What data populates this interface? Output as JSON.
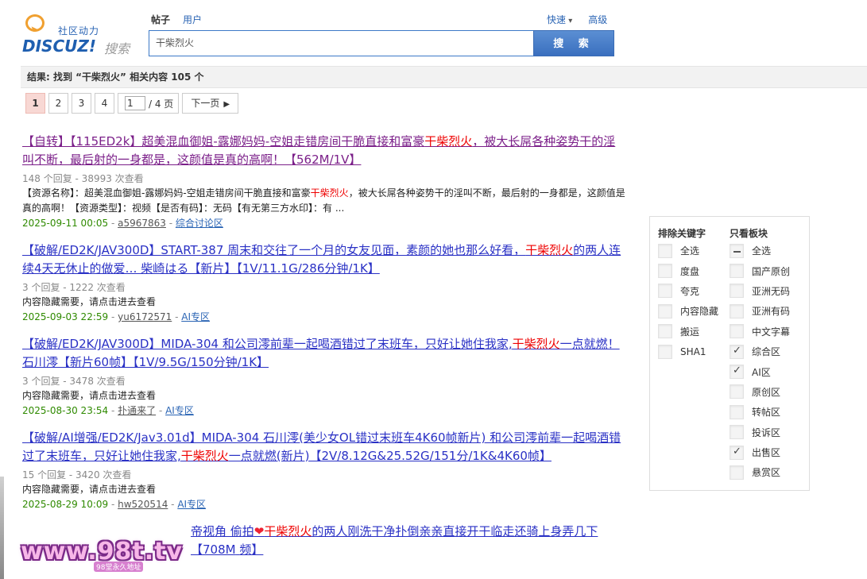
{
  "logo": {
    "cn": "社区动力",
    "word": "DISCUZ!",
    "sou": "搜索"
  },
  "search_tabs": [
    "帖子",
    "用户"
  ],
  "search_options": {
    "quick": "快速",
    "advanced": "高级"
  },
  "search": {
    "value": "干柴烈火",
    "button": "搜 索"
  },
  "result_summary": "结果: 找到 “干柴烈火” 相关内容 105 个",
  "pager": {
    "pages": [
      "1",
      "2",
      "3",
      "4"
    ],
    "current_input": "1",
    "total": "/ 4 页",
    "next": "下一页"
  },
  "results": [
    {
      "title_pre": "【自转】【115ED2k】超美混血御姐-露娜妈妈-空姐走错房间干脆直接和富豪",
      "title_hl": "干柴烈火",
      "title_post": "，被大长屌各种姿势干的淫叫不断，最后射的一身都是，这颜值是真的高啊！【562M/1V】",
      "meta": "148 个回复 - 38993 次查看",
      "desc_pre": "【资源名称】：超美混血御姐-露娜妈妈-空姐走错房间干脆直接和富豪",
      "desc_hl": "干柴烈火",
      "desc_post": "，被大长屌各种姿势干的淫叫不断，最后射的一身都是，这颜值是真的高啊！【资源类型】：视频【是否有码】：无码【有无第三方水印】：有 ...",
      "date": "2025-09-11 00:05",
      "author": "a5967863",
      "forum": "综合讨论区"
    },
    {
      "title_pre": "【破解/ED2K/JAV300D】START-387 周末和交往了一个月的女友见面，素颜的她也那么好看，",
      "title_hl": "干柴烈火",
      "title_post": "的两人连续4天无休止的做爱… 柴崎はる【新片】【1V/11.1G/286分钟/1K】",
      "meta": "3 个回复 - 1222 次查看",
      "desc": "内容隐藏需要，请点击进去查看",
      "date": "2025-09-03 22:59",
      "author": "yu6172571",
      "forum": "AI专区"
    },
    {
      "title_pre": "【破解/ED2K/JAV300D】MIDA-304 和公司澪前辈一起喝酒错过了末班车，只好让她住我家,",
      "title_hl": "干柴烈火",
      "title_post": "一点就燃！石川澪【新片60帧】【1V/9.5G/150分钟/1K】",
      "meta": "3 个回复 - 3478 次查看",
      "desc": "内容隐藏需要，请点击进去查看",
      "date": "2025-08-30 23:54",
      "author": "扑通来了",
      "forum": "AI专区"
    },
    {
      "title_pre": "【破解/AI增强/ED2K/Jav3.01d】MIDA-304 石川澪(美少女OL错过末班车4K60帧新片) 和公司澪前辈一起喝酒错过了末班车，只好让她住我家,",
      "title_hl": "干柴烈火",
      "title_post": "一点就燃(新片)【2V/8.12G&25.52G/151分/1K&4K60帧】",
      "meta": "15 个回复 - 3420 次查看",
      "desc": "内容隐藏需要，请点击进去查看",
      "date": "2025-08-29 10:09",
      "author": "hw520514",
      "forum": "AI专区"
    },
    {
      "title_pre": "帝视角 偷拍",
      "title_hl": "干柴烈火",
      "title_post": "的两人刚洗干净扑倒亲亲直接开干临走还骑上身弄几下【708M",
      "title_tail": "频】"
    }
  ],
  "filter": {
    "exclude_header": "排除关键字",
    "exclude": [
      "全选",
      "度盘",
      "夸克",
      "内容隐藏",
      "搬运",
      "SHA1"
    ],
    "only_header": "只看板块",
    "only": [
      {
        "label": "全选",
        "state": "mixed"
      },
      {
        "label": "国产原创",
        "state": "off"
      },
      {
        "label": "亚洲无码",
        "state": "off"
      },
      {
        "label": "亚洲有码",
        "state": "off"
      },
      {
        "label": "中文字幕",
        "state": "off"
      },
      {
        "label": "综合区",
        "state": "on"
      },
      {
        "label": "AI区",
        "state": "on"
      },
      {
        "label": "原创区",
        "state": "off"
      },
      {
        "label": "转帖区",
        "state": "off"
      },
      {
        "label": "投诉区",
        "state": "off"
      },
      {
        "label": "出售区",
        "state": "on"
      },
      {
        "label": "悬赏区",
        "state": "off"
      }
    ]
  },
  "watermark": {
    "text": "www.98t.tv",
    "sub": "98堂永久地址"
  }
}
